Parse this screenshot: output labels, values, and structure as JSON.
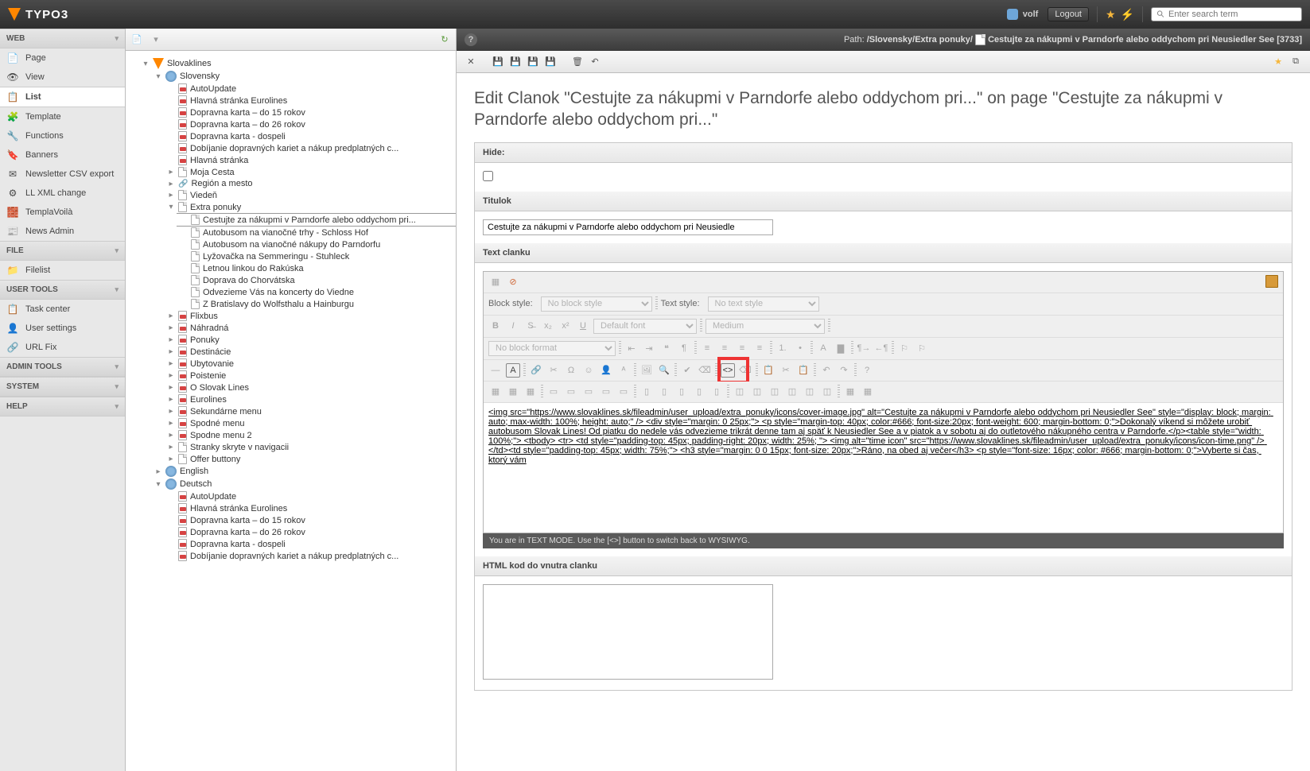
{
  "topbar": {
    "brand": "TYPO3",
    "username": "volf",
    "logout": "Logout",
    "search_placeholder": "Enter search term"
  },
  "modules": {
    "groups": [
      {
        "label": "WEB",
        "items": [
          {
            "key": "page",
            "label": "Page",
            "icon": "📄"
          },
          {
            "key": "view",
            "label": "View",
            "icon": "👁"
          },
          {
            "key": "list",
            "label": "List",
            "icon": "📋",
            "active": true
          },
          {
            "key": "template",
            "label": "Template",
            "icon": "🧩"
          },
          {
            "key": "functions",
            "label": "Functions",
            "icon": "🔧"
          },
          {
            "key": "banners",
            "label": "Banners",
            "icon": "🔖"
          },
          {
            "key": "newsletter",
            "label": "Newsletter CSV export",
            "icon": "✉"
          },
          {
            "key": "llxml",
            "label": "LL XML change",
            "icon": "⚙"
          },
          {
            "key": "templavoila",
            "label": "TemplaVoilà",
            "icon": "🧱"
          },
          {
            "key": "newsadmin",
            "label": "News Admin",
            "icon": "📰"
          }
        ]
      },
      {
        "label": "FILE",
        "items": [
          {
            "key": "filelist",
            "label": "Filelist",
            "icon": "📁"
          }
        ]
      },
      {
        "label": "USER TOOLS",
        "items": [
          {
            "key": "taskcenter",
            "label": "Task center",
            "icon": "📋"
          },
          {
            "key": "usersettings",
            "label": "User settings",
            "icon": "👤"
          },
          {
            "key": "urlfix",
            "label": "URL Fix",
            "icon": "🔗"
          }
        ]
      },
      {
        "label": "ADMIN TOOLS",
        "collapsed": true,
        "items": []
      },
      {
        "label": "SYSTEM",
        "collapsed": true,
        "items": []
      },
      {
        "label": "HELP",
        "collapsed": true,
        "items": []
      }
    ]
  },
  "tree": {
    "root": "Slovaklines",
    "sk_label": "Slovensky",
    "sk_children": [
      "AutoUpdate",
      "Hlavná stránka Eurolines",
      "Dopravna karta – do 15 rokov",
      "Dopravna karta – do 26 rokov",
      "Dopravna karta - dospeli",
      "Dobíjanie dopravných kariet a nákup predplatných c...",
      "Hlavná stránka"
    ],
    "moja_cesta": "Moja Cesta",
    "region": "Región a mesto",
    "vieden": "Viedeň",
    "extra_ponuky": "Extra ponuky",
    "extra_children": [
      "Cestujte za nákupmi v Parndorfe alebo oddychom pri...",
      "Autobusom na vianočné trhy - Schloss Hof",
      "Autobusom na vianočné nákupy do Parndorfu",
      "Lyžovačka na Semmeringu - Stuhleck",
      "Letnou linkou do Rakúska",
      "Doprava do Chorvátska",
      "Odvezieme Vás na koncerty do Viedne",
      "Z Bratislavy do Wolfsthalu a Hainburgu"
    ],
    "tail": [
      "Flixbus",
      "Náhradná",
      "Ponuky",
      "Destinácie",
      "Ubytovanie",
      "Poistenie",
      "O Slovak Lines",
      "Eurolines",
      "Sekundárne menu",
      "Spodné menu",
      "Spodne menu 2",
      "Stranky skryte v navigacii",
      "Offer buttony"
    ],
    "en_label": "English",
    "de_label": "Deutsch",
    "de_children": [
      "AutoUpdate",
      "Hlavná stránka Eurolines",
      "Dopravna karta – do 15 rokov",
      "Dopravna karta – do 26 rokov",
      "Dopravna karta - dospeli",
      "Dobíjanie dopravných kariet a nákup predplatných c..."
    ]
  },
  "docheader": {
    "path_label": "Path:",
    "path": "/Slovensky/Extra ponuky/",
    "title": "Cestujte za nákupmi v Parndorfe alebo oddychom pri Neusiedler See [3733]"
  },
  "edit": {
    "heading": "Edit Clanok \"Cestujte za nákupmi v Parndorfe alebo oddychom pri...\" on page \"Cestujte za nákupmi v Parndorfe alebo oddychom pri...\"",
    "hide_label": "Hide:",
    "titulok_label": "Titulok",
    "titulok_value": "Cestujte za nákupmi v Parndorfe alebo oddychom pri Neusiedle",
    "textclanku_label": "Text clanku",
    "htmlkod_label": "HTML kod do vnutra clanku",
    "rte_status": "You are in TEXT MODE. Use the [<>] button to switch back to WYSIWYG."
  },
  "rte": {
    "blockstyle_label": "Block style:",
    "blockstyle_value": "No block style",
    "textstyle_label": "Text style:",
    "textstyle_value": "No text style",
    "font_value": "Default font",
    "size_value": "Medium",
    "format_value": "No block format",
    "source": "<img src=\"https://www.slovaklines.sk/fileadmin/user_upload/extra_ponuky/icons/cover-image.jpg\" alt=\"Cestujte za nákupmi v Parndorfe alebo oddychom pri Neusiedler See\" style=\"display: block; margin: auto; max-width: 100%; height: auto;\" /> <div style=\"margin: 0 25px;\"> <p style=\"margin-top: 40px; color:#666; font-size:20px; font-weight: 600; margin-bottom: 0;\">Dokonalý víkend si môžete urobiť autobusom Slovak Lines! Od piatku do nedele vás odvezieme trikrát denne tam aj späť k Neusiedler See a v piatok a v sobotu aj do outletového nákupného centra v Parndorfe.</p><table style=\"width: 100%;\"> <tbody> <tr> <td style=\"padding-top: 45px; padding-right: 20px; width: 25%; \"> <img alt=\"time icon\" src=\"https://www.slovaklines.sk/fileadmin/user_upload/extra_ponuky/icons/icon-time.png\" /> </td><td style=\"padding-top: 45px; width: 75%;\"> <h3 style=\"margin: 0 0 15px; font-size: 20px;\">Ráno, na obed aj večer</h3> <p style=\"font-size: 16px; color: #666; margin-bottom: 0;\">Vyberte si čas, ktorý vám"
  }
}
